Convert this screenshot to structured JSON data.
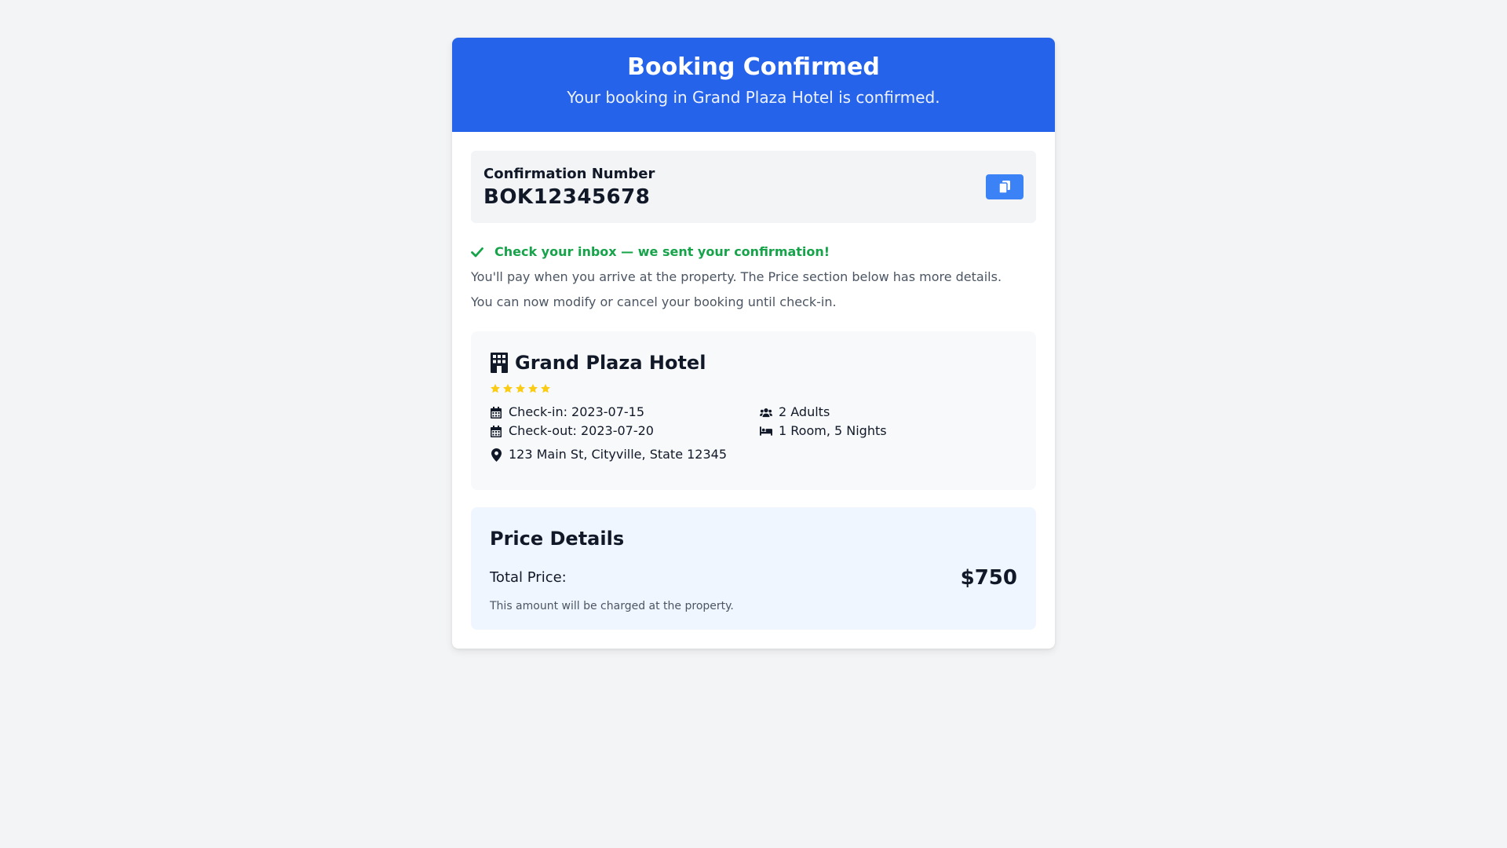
{
  "header": {
    "title": "Booking Confirmed",
    "subtitle": "Your booking in Grand Plaza Hotel is confirmed."
  },
  "confirmation": {
    "label": "Confirmation Number",
    "number": "BOK12345678",
    "copy_icon": "copy-icon"
  },
  "notice": {
    "headline": "Check your inbox — we sent your confirmation!",
    "line1": "You'll pay when you arrive at the property. The Price section below has more details.",
    "line2": "You can now modify or cancel your booking until check-in."
  },
  "hotel": {
    "name": "Grand Plaza Hotel",
    "icon": "hotel-icon",
    "rating": 5,
    "check_in": "Check-in: 2023-07-15",
    "check_out": "Check-out: 2023-07-20",
    "guests": "2 Adults",
    "rooms": "1 Room, 5 Nights",
    "address": "123 Main St, Cityville, State 12345"
  },
  "price": {
    "title": "Price Details",
    "label": "Total Price:",
    "value": "$750",
    "note": "This amount will be charged at the property."
  },
  "colors": {
    "primary": "#2563eb",
    "button": "#3b82f6",
    "success": "#16a34a",
    "star": "#facc15"
  }
}
